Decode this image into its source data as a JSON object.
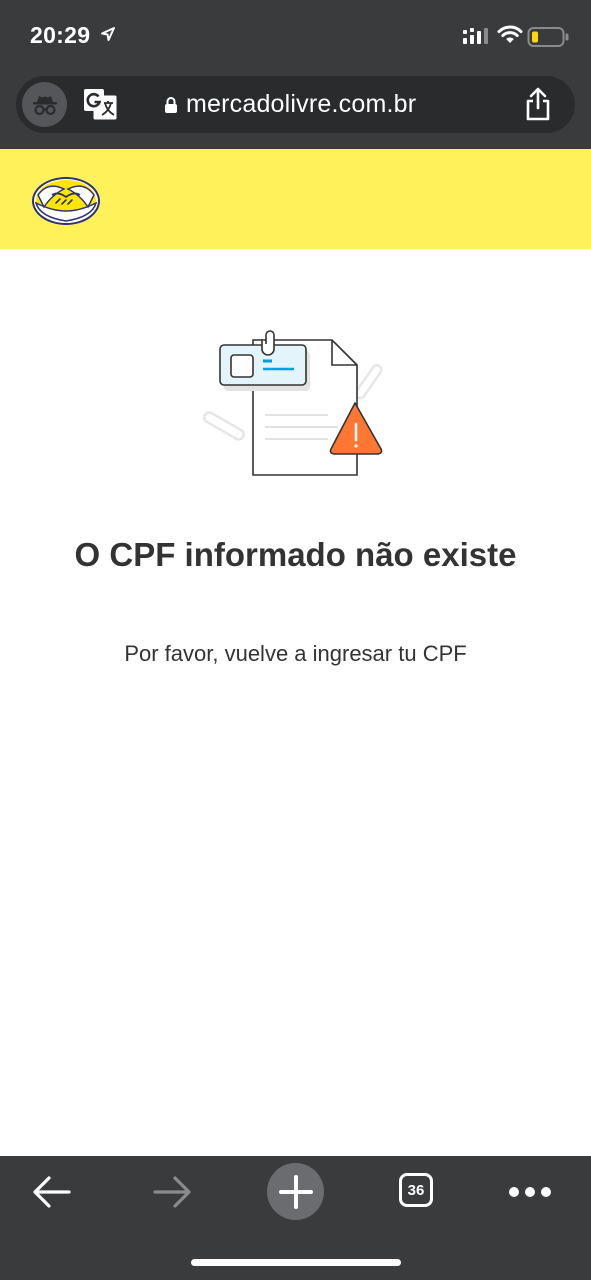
{
  "status_bar": {
    "time": "20:29",
    "icons": [
      "location-arrow-icon",
      "cellular-signal-icon",
      "wifi-icon",
      "battery-icon"
    ]
  },
  "browser": {
    "url": "mercadolivre.com.br",
    "buttons": [
      "incognito-icon",
      "translate-icon",
      "lock-icon",
      "share-icon"
    ]
  },
  "header": {
    "brand": "Mercado Livre",
    "logo": "mercado-livre-handshake-logo",
    "background": "#fff159"
  },
  "message": {
    "illustration": "document-warning-illustration",
    "title": "O CPF informado não existe",
    "subtitle": "Por favor, vuelve a ingresar tu CPF"
  },
  "toolbar": {
    "tab_count": "36",
    "buttons": [
      "back-arrow-icon",
      "forward-arrow-icon",
      "plus-icon",
      "tabs-icon",
      "more-icon"
    ]
  },
  "colors": {
    "chrome": "#3a3b3d",
    "brand_yellow": "#fff159",
    "warning_orange": "#ff7733",
    "text": "#333333"
  }
}
